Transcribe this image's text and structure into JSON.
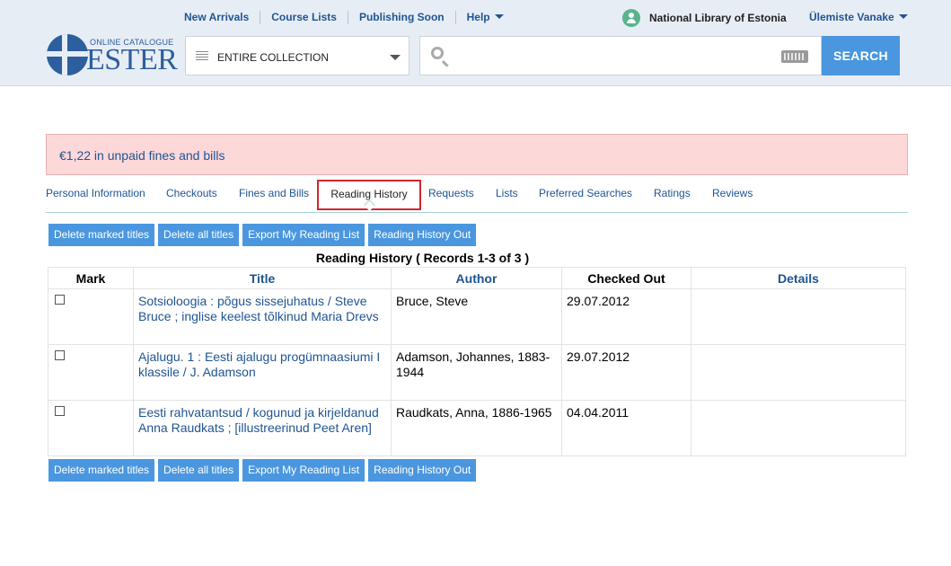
{
  "header": {
    "nav": [
      "New Arrivals",
      "Course Lists",
      "Publishing Soon",
      "Help"
    ],
    "library": "National Library of Estonia",
    "branch": "Ülemiste Vanake",
    "logo_small": "ONLINE CATALOGUE",
    "logo_big": "ESTER",
    "collection": "ENTIRE COLLECTION",
    "search_value": "",
    "search_button": "SEARCH"
  },
  "alert": "€1,22 in unpaid fines and bills",
  "tabs": [
    "Personal Information",
    "Checkouts",
    "Fines and Bills",
    "Reading History",
    "Requests",
    "Lists",
    "Preferred Searches",
    "Ratings",
    "Reviews"
  ],
  "active_tab": "Reading History",
  "buttons": [
    "Delete marked titles",
    "Delete all titles",
    "Export My Reading List",
    "Reading History Out"
  ],
  "caption": "Reading History ( Records 1-3 of 3 )",
  "columns": [
    "Mark",
    "Title",
    "Author",
    "Checked Out",
    "Details"
  ],
  "rows": [
    {
      "title": "Sotsioloogia : põgus sissejuhatus / Steve Bruce ; inglise keelest tõlkinud Maria Drevs",
      "author": "Bruce, Steve",
      "checked_out": "29.07.2012",
      "details": ""
    },
    {
      "title": "Ajalugu. 1 : Eesti ajalugu progümnaasiumi I klassile / J. Adamson",
      "author": "Adamson, Johannes, 1883-1944",
      "checked_out": "29.07.2012",
      "details": ""
    },
    {
      "title": "Eesti rahvatantsud / kogunud ja kirjeldanud Anna Raudkats ; [illustreerinud Peet Aren]",
      "author": "Raudkats, Anna, 1886-1965",
      "checked_out": "04.04.2011",
      "details": ""
    }
  ],
  "colors": {
    "accent": "#4a97df",
    "link": "#1f5493",
    "alert_bg": "#fdd8d9",
    "active_tab_border": "#d22630"
  },
  "icons": {
    "user": "user-icon",
    "collection": "list-icon",
    "search": "search-icon",
    "keyboard": "keyboard-icon"
  }
}
